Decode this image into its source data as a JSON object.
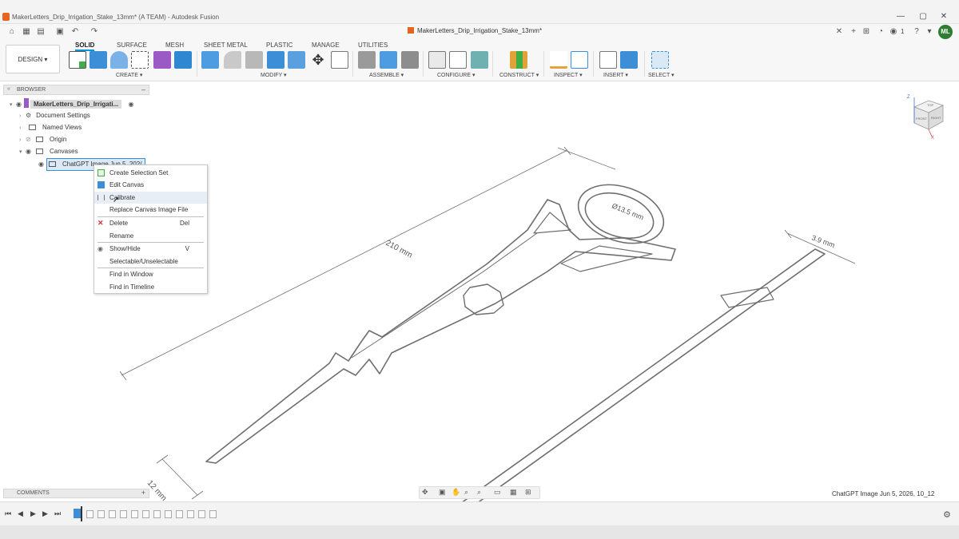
{
  "window": {
    "title": "MakerLetters_Drip_Irrigation_Stake_13mm* (A TEAM) - Autodesk Fusion",
    "controls": [
      "—",
      "▢",
      "✕"
    ]
  },
  "quickbar": {
    "doc_tab": "MakerLetters_Drip_Irrigation_Stake_13mm*",
    "badge_count": "1",
    "user_initials": "ML"
  },
  "workspace": {
    "label": "DESIGN ▾"
  },
  "tabs": [
    "SOLID",
    "SURFACE",
    "MESH",
    "SHEET METAL",
    "PLASTIC",
    "MANAGE",
    "UTILITIES"
  ],
  "groups": [
    "CREATE ▾",
    "MODIFY ▾",
    "ASSEMBLE ▾",
    "CONFIGURE ▾",
    "CONSTRUCT ▾",
    "INSPECT ▾",
    "INSERT ▾",
    "SELECT ▾"
  ],
  "browser": {
    "title": "BROWSER",
    "root": "MakerLetters_Drip_Irrigati...",
    "items": [
      "Document Settings",
      "Named Views",
      "Origin",
      "Canvases"
    ],
    "canvas_item": "ChatGPT Image Jun 5, 202("
  },
  "context_menu": {
    "items": [
      {
        "label": "Create Selection Set",
        "key": ""
      },
      {
        "label": "Edit Canvas",
        "key": ""
      },
      {
        "label": "Calibrate",
        "key": ""
      },
      {
        "label": "Replace Canvas Image File",
        "key": ""
      },
      {
        "label": "Delete",
        "key": "Del"
      },
      {
        "label": "Rename",
        "key": ""
      },
      {
        "label": "Show/Hide",
        "key": "V"
      },
      {
        "label": "Selectable/Unselectable",
        "key": ""
      },
      {
        "label": "Find in Window",
        "key": ""
      },
      {
        "label": "Find in Timeline",
        "key": ""
      }
    ]
  },
  "comments": {
    "label": "COMMENTS"
  },
  "viewport": {
    "dimensions": [
      "210 mm",
      "Ø13.5 mm",
      "3.9 mm",
      "12 mm"
    ],
    "canvas_label": "ChatGPT Image Jun 5, 2026, 10_12"
  },
  "viewcube": {
    "top": "TOP",
    "front": "FRONT",
    "right": "RIGHT",
    "axis_z": "Z",
    "axis_x": "X"
  },
  "colors": {
    "accent": "#0696d7",
    "brand": "#e8641e",
    "avatar": "#2e7d32"
  }
}
